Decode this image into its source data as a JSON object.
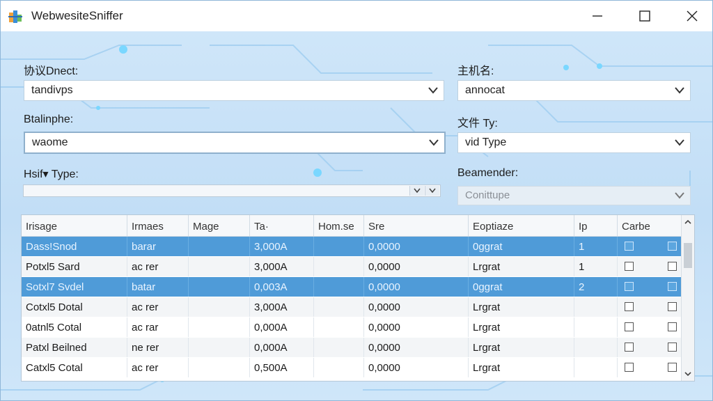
{
  "window": {
    "title": "WebwesiteSniffer"
  },
  "fields": {
    "protocol": {
      "label": "协议Dnect:",
      "value": "tandivps"
    },
    "host": {
      "label": "主机名:",
      "value": "annocat"
    },
    "blalinphe": {
      "label": "Btalinphe:",
      "value": "waome"
    },
    "filetype": {
      "label": "文件 Ty:",
      "value": "vid Type"
    },
    "hash": {
      "label": "Hsif▾ Type:",
      "value": ""
    },
    "beamender": {
      "label": "Beamender:",
      "value": "Conittupe"
    }
  },
  "table": {
    "headers": [
      "Irisage",
      "Irmaes",
      "Mage",
      "Ta·",
      "Hom.se",
      "Sre",
      "Eoptiaze",
      "Ip",
      "Carbe"
    ],
    "rows": [
      {
        "c0": "Dass!Snod",
        "c1": "barar",
        "c3": "3,000A",
        "c5": "0,0000",
        "c6": "0ggrat",
        "c7": "1",
        "selected": true
      },
      {
        "c0": "Potxl5 Sard",
        "c1": "ac rer",
        "c3": "3,000A",
        "c5": "0,0000",
        "c6": "Lrgrat",
        "c7": "1",
        "selected": false
      },
      {
        "c0": "Sotxl7 Svdel",
        "c1": "batar",
        "c3": "0,003A",
        "c5": "0,0000",
        "c6": "0ggrat",
        "c7": "2",
        "selected": true
      },
      {
        "c0": "Cotxl5 Dotal",
        "c1": "ac rer",
        "c3": "3,000A",
        "c5": "0,0000",
        "c6": "Lrgrat",
        "c7": "",
        "selected": false
      },
      {
        "c0": "0atnl5 Cotal",
        "c1": "ac rar",
        "c3": "0,000A",
        "c5": "0,0000",
        "c6": "Lrgrat",
        "c7": "",
        "selected": false
      },
      {
        "c0": "Patxl Beilned",
        "c1": "ne rer",
        "c3": "0,000A",
        "c5": "0,0000",
        "c6": "Lrgrat",
        "c7": "",
        "selected": false
      },
      {
        "c0": "Catxl5 Cotal",
        "c1": "ac rer",
        "c3": "0,500A",
        "c5": "0,0000",
        "c6": "Lrgrat",
        "c7": "",
        "selected": false
      }
    ]
  },
  "colors": {
    "selection": "#4f9bd8",
    "background": "#cfe6f9"
  },
  "icons": [
    "app-icon",
    "minimize-icon",
    "maximize-icon",
    "close-icon",
    "chevron-down-icon",
    "scroll-up-icon",
    "scroll-down-icon"
  ]
}
